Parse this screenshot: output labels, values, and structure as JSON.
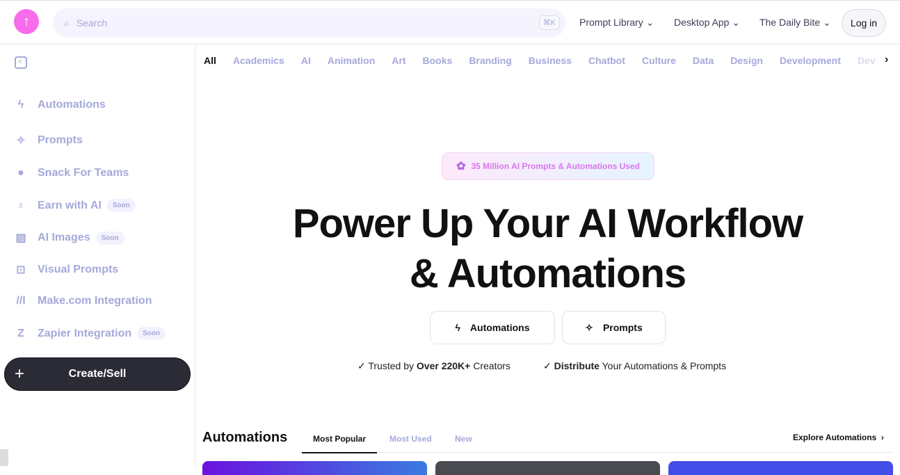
{
  "header": {
    "search_placeholder": "Search",
    "search_shortcut": "⌘K",
    "nav": [
      "Prompt Library",
      "Desktop App",
      "The Daily Bite"
    ],
    "login": "Log in"
  },
  "sidebar": {
    "items": [
      {
        "label": "Automations",
        "icon": "bolt-icon"
      },
      {
        "label": "Prompts",
        "icon": "sparkle-icon"
      },
      {
        "label": "Snack For Teams",
        "icon": "snack-logo-icon"
      },
      {
        "label": "Earn with AI",
        "icon": "money-bag-icon",
        "badge": "Soon"
      },
      {
        "label": "AI Images",
        "icon": "image-icon",
        "badge": "Soon"
      },
      {
        "label": "Visual Prompts",
        "icon": "visual-prompt-icon"
      },
      {
        "label": "Make.com Integration",
        "icon": "make-logo-icon"
      },
      {
        "label": "Zapier Integration",
        "icon": "zapier-logo-icon",
        "badge": "Soon"
      }
    ],
    "create": "Create/Sell"
  },
  "categories": [
    "All",
    "Academics",
    "AI",
    "Animation",
    "Art",
    "Books",
    "Branding",
    "Business",
    "Chatbot",
    "Culture",
    "Data",
    "Design",
    "Development",
    "Dev"
  ],
  "hero": {
    "badge": "35 Million AI Prompts & Automations Used",
    "title_line1": "Power Up Your AI Workflow",
    "title_line2": "& Automations",
    "btn_automations": "Automations",
    "btn_prompts": "Prompts",
    "trust1_pre": "Trusted by ",
    "trust1_bold": "Over 220K+",
    "trust1_post": " Creators",
    "trust2_bold": "Distribute",
    "trust2_post": " Your Automations & Prompts"
  },
  "automations": {
    "title": "Automations",
    "tabs": [
      "Most Popular",
      "Most Used",
      "New"
    ],
    "explore": "Explore Automations"
  },
  "colors": {
    "brand": "#f86bea",
    "muted": "#a5a9d9",
    "dark": "#2b2b36"
  }
}
